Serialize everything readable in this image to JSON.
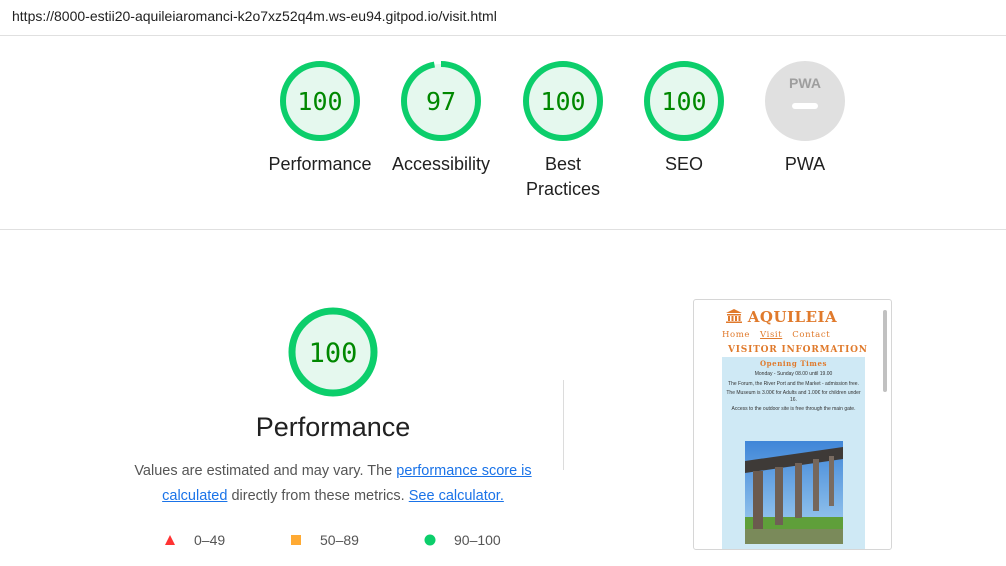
{
  "url": "https://8000-estii20-aquileiaromanci-k2o7xz52q4m.ws-eu94.gitpod.io/visit.html",
  "gauges": [
    {
      "score": "100",
      "label": "Performance",
      "fraction": 1.0
    },
    {
      "score": "97",
      "label": "Accessibility",
      "fraction": 0.97
    },
    {
      "score": "100",
      "label": "Best Practices",
      "fraction": 1.0
    },
    {
      "score": "100",
      "label": "SEO",
      "fraction": 1.0
    },
    {
      "score": "",
      "label": "PWA",
      "fraction": 0
    }
  ],
  "pwa_badge": "PWA",
  "performance": {
    "score": "100",
    "fraction": 1.0,
    "title": "Performance",
    "desc_prefix": "Values are estimated and may vary. The ",
    "desc_link1": "performance score is calculated",
    "desc_middle": " directly from these metrics. ",
    "desc_link2": "See calculator."
  },
  "legend": [
    {
      "range": "0–49",
      "shape": "triangle",
      "color": "#ff3333"
    },
    {
      "range": "50–89",
      "shape": "square",
      "color": "#ffaa33"
    },
    {
      "range": "90–100",
      "shape": "circle",
      "color": "#0cce6b"
    }
  ],
  "colors": {
    "pass_ring": "#0cce6b",
    "pass_fill": "#e5f8ee",
    "pass_text": "#008800",
    "link": "#1a73e8",
    "brand_orange": "#e07a2c",
    "site_bg": "#cfe9f5"
  },
  "thumbnail": {
    "logo_icon": "temple-icon",
    "logo_text": "AQUILEIA",
    "nav": [
      "Home",
      "Visit",
      "Contact"
    ],
    "nav_active": "Visit",
    "heading": "VISITOR INFORMATION",
    "subheading": "Opening Times",
    "paragraphs": [
      "Monday - Sunday 08.00 until 19.00",
      "The Forum, the River Port and the Market - admission free.",
      "The Museum is 3.00€ for Adults and 1.00€ for children under 16.",
      "Access to the outdoor site is free through the main gate."
    ]
  }
}
